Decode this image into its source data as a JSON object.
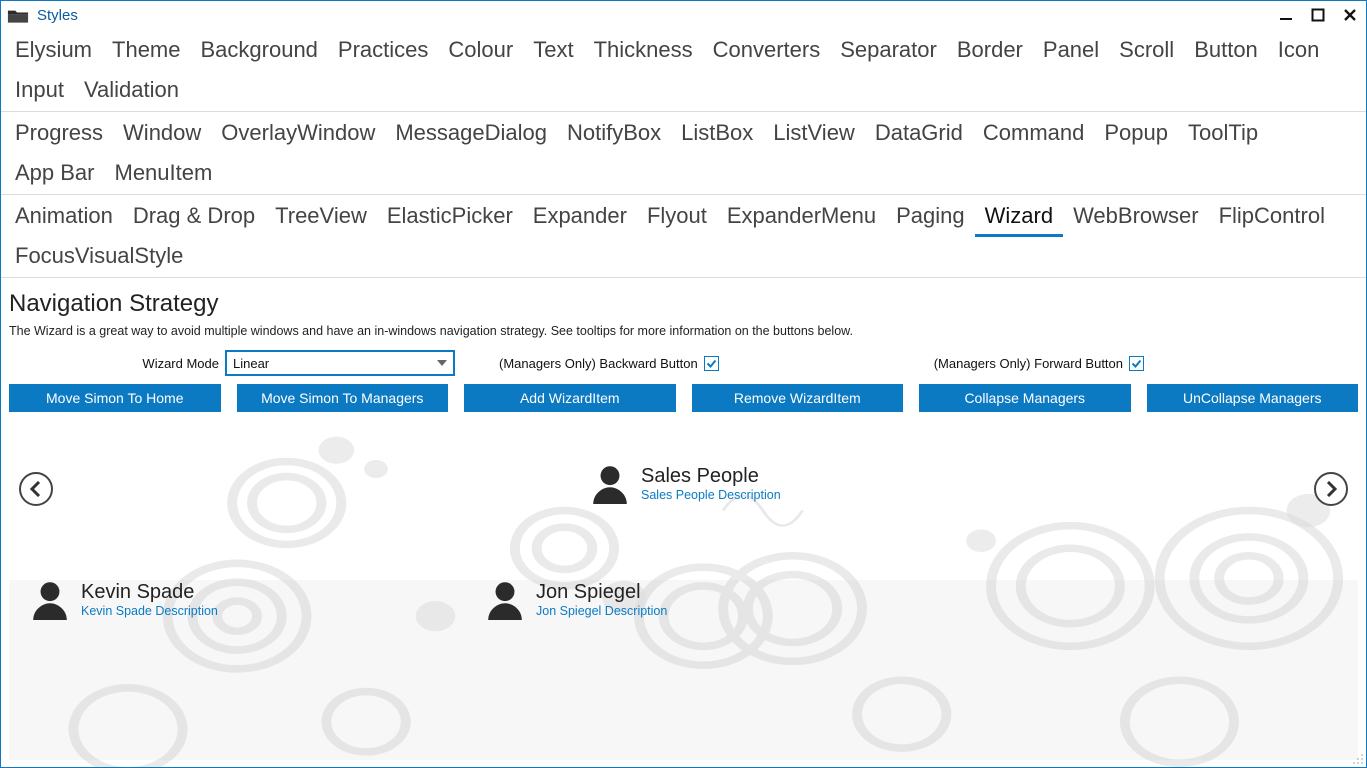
{
  "window": {
    "title": "Styles"
  },
  "tabs_row1": [
    "Elysium",
    "Theme",
    "Background",
    "Practices",
    "Colour",
    "Text",
    "Thickness",
    "Converters",
    "Separator",
    "Border",
    "Panel",
    "Scroll",
    "Button",
    "Icon",
    "Input",
    "Validation"
  ],
  "tabs_row2": [
    "Progress",
    "Window",
    "OverlayWindow",
    "MessageDialog",
    "NotifyBox",
    "ListBox",
    "ListView",
    "DataGrid",
    "Command",
    "Popup",
    "ToolTip",
    "App Bar",
    "MenuItem"
  ],
  "tabs_row3": [
    "Animation",
    "Drag & Drop",
    "TreeView",
    "ElasticPicker",
    "Expander",
    "Flyout",
    "ExpanderMenu",
    "Paging",
    "Wizard",
    "WebBrowser",
    "FlipControl",
    "FocusVisualStyle"
  ],
  "active_tab": "Wizard",
  "page": {
    "title": "Navigation Strategy",
    "description": "The Wizard is a great way to avoid multiple windows and have an in-windows navigation strategy. See tooltips for more information on the buttons below."
  },
  "controls": {
    "wizard_mode_label": "Wizard Mode",
    "wizard_mode_value": "Linear",
    "backward_label": "(Managers Only) Backward Button",
    "backward_checked": true,
    "forward_label": "(Managers Only) Forward Button",
    "forward_checked": true
  },
  "actions": {
    "move_home": "Move Simon To Home",
    "move_managers": "Move Simon To Managers",
    "add_item": "Add WizardItem",
    "remove_item": "Remove WizardItem",
    "collapse": "Collapse Managers",
    "uncollapse": "UnCollapse Managers"
  },
  "cards": {
    "top": {
      "name": "Sales People",
      "desc": "Sales People Description"
    },
    "left": {
      "name": "Kevin Spade",
      "desc": "Kevin Spade Description"
    },
    "right": {
      "name": "Jon Spiegel",
      "desc": "Jon Spiegel Description"
    }
  }
}
